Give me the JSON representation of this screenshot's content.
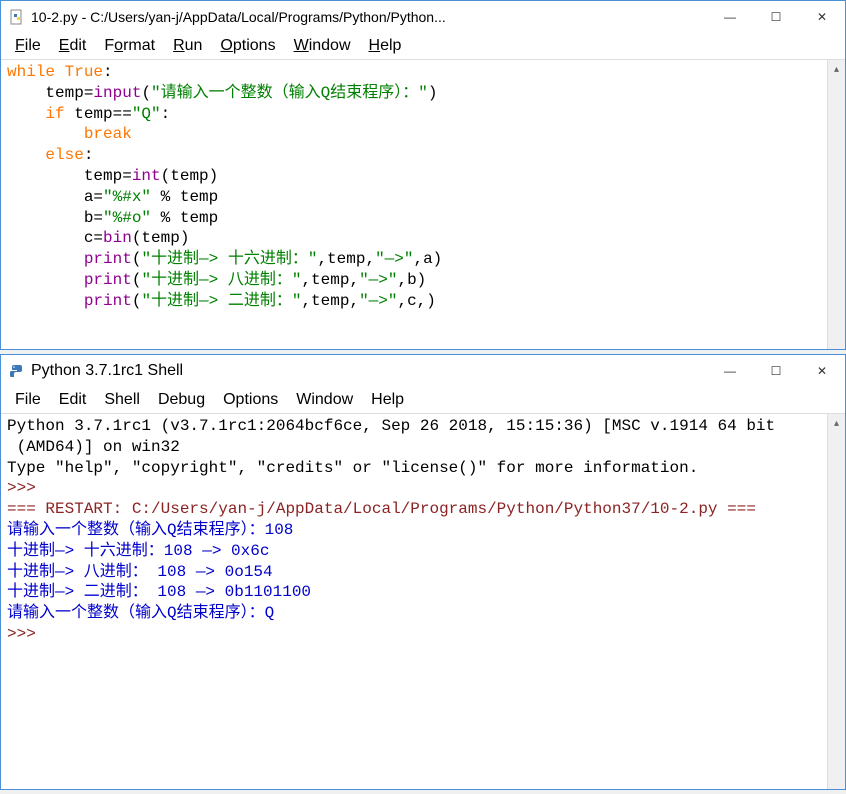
{
  "editor": {
    "title": "10-2.py - C:/Users/yan-j/AppData/Local/Programs/Python/Python...",
    "menus": [
      "File",
      "Edit",
      "Format",
      "Run",
      "Options",
      "Window",
      "Help"
    ],
    "code": {
      "line1_while": "while",
      "line1_true": " True",
      "line1_colon": ":",
      "line2_temp": "    temp=",
      "line2_input": "input",
      "line2_paren_open": "(",
      "line2_str": "\"请输入一个整数（输入Q结束程序）：\"",
      "line2_paren_close": ")",
      "line3_if": "    if",
      "line3_cond": " temp==",
      "line3_q": "\"Q\"",
      "line3_colon": ":",
      "line4_break": "        break",
      "line5_else": "    else",
      "line5_colon": ":",
      "line6": "        temp=",
      "line6_int": "int",
      "line6_rest": "(temp)",
      "line7_a": "        a=",
      "line7_str": "\"%#x\"",
      "line7_rest": " % temp",
      "line8_b": "        b=",
      "line8_str": "\"%#o\"",
      "line8_rest": " % temp",
      "line9_c": "        c=",
      "line9_bin": "bin",
      "line9_rest": "(temp)",
      "line10_print": "        print",
      "line10_paren": "(",
      "line10_str": "\"十进制—> 十六进制：\"",
      "line10_mid": ",temp,",
      "line10_arrow": "\"—>\"",
      "line10_end": ",a)",
      "line11_print": "        print",
      "line11_paren": "(",
      "line11_str": "\"十进制—> 八进制：\"",
      "line11_mid": ",temp,",
      "line11_arrow": "\"—>\"",
      "line11_end": ",b)",
      "line12_print": "        print",
      "line12_paren": "(",
      "line12_str": "\"十进制—> 二进制：\"",
      "line12_mid": ",temp,",
      "line12_arrow": "\"—>\"",
      "line12_end": ",c,)"
    }
  },
  "shell": {
    "title": "Python 3.7.1rc1 Shell",
    "menus": [
      "File",
      "Edit",
      "Shell",
      "Debug",
      "Options",
      "Window",
      "Help"
    ],
    "header1": "Python 3.7.1rc1 (v3.7.1rc1:2064bcf6ce, Sep 26 2018, 15:15:36) [MSC v.1914 64 bit",
    "header2": " (AMD64)] on win32",
    "header3": "Type \"help\", \"copyright\", \"credits\" or \"license()\" for more information.",
    "prompt1": ">>>",
    "restart": "=== RESTART: C:/Users/yan-j/AppData/Local/Programs/Python/Python37/10-2.py ===",
    "out1": "请输入一个整数（输入Q结束程序）：108",
    "out2": "十进制—> 十六进制：108 —> 0x6c",
    "out3": "十进制—> 八进制： 108 —> 0o154",
    "out4": "十进制—> 二进制： 108 —> 0b1101100",
    "out5": "请输入一个整数（输入Q结束程序）：Q",
    "prompt2": ">>>"
  },
  "win_controls": {
    "min": "—",
    "max": "☐",
    "close": "✕"
  }
}
